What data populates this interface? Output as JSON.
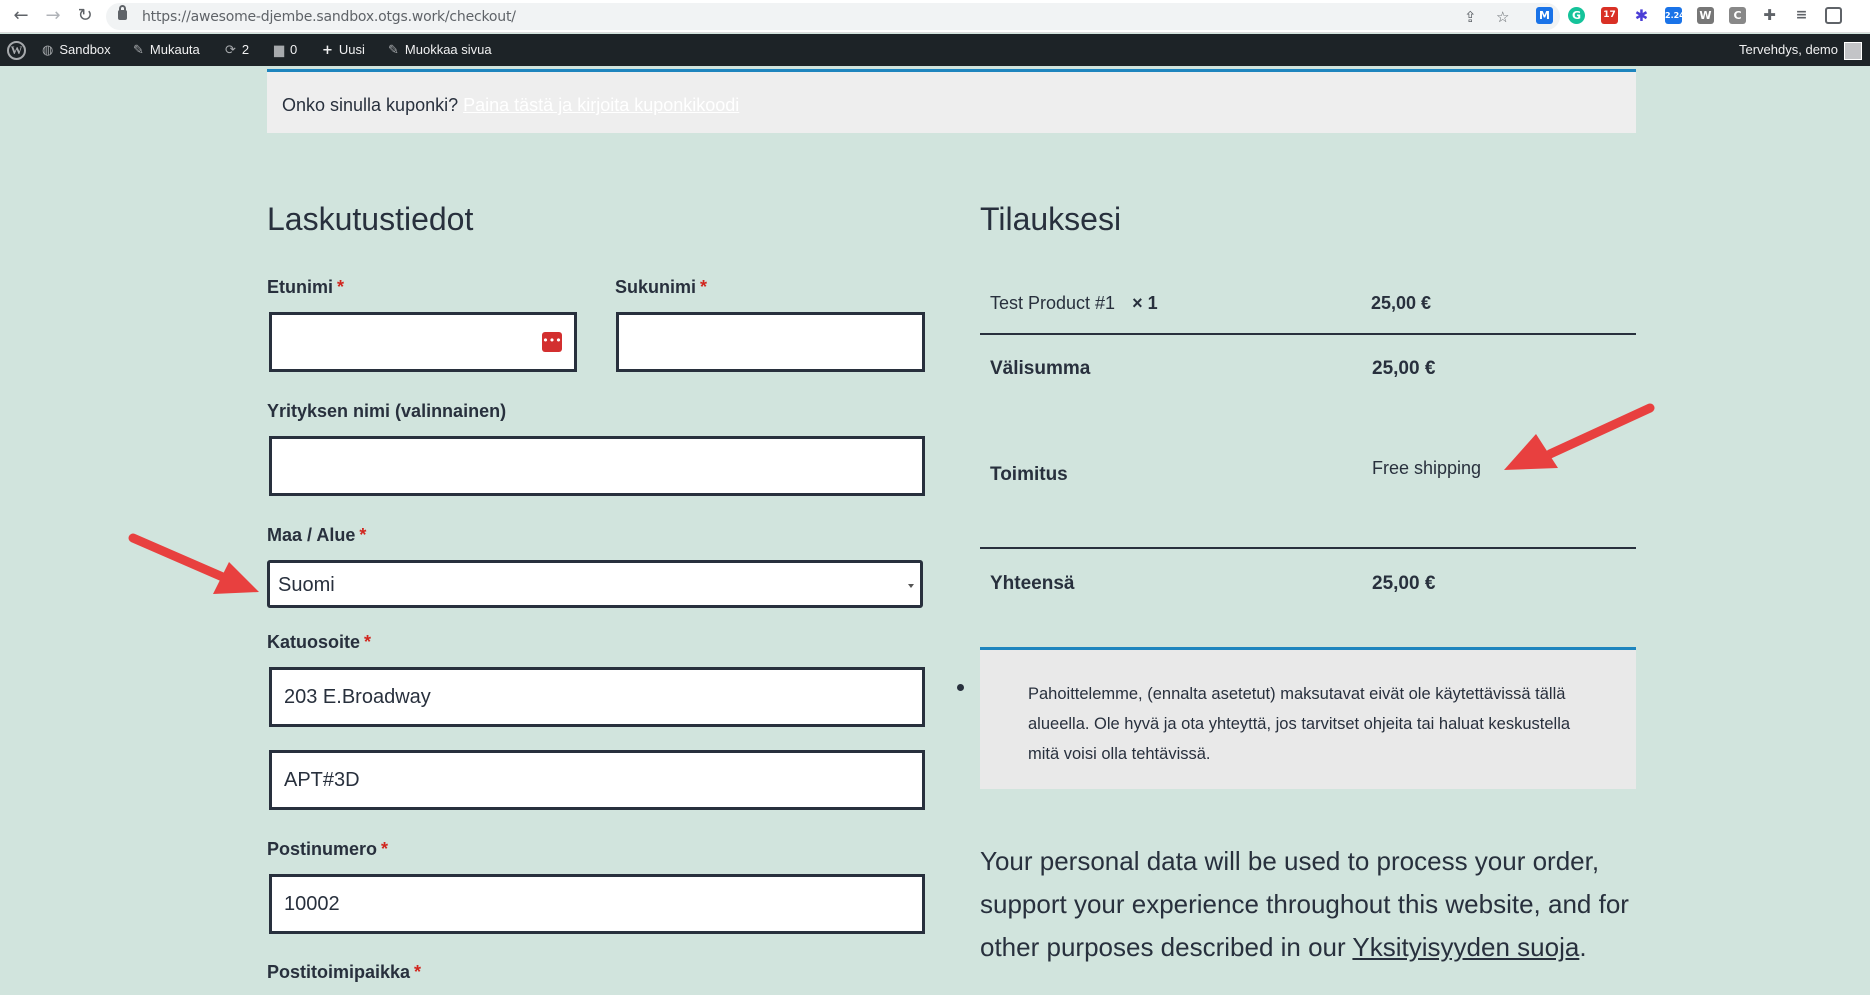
{
  "browser": {
    "url": "https://awesome-djembe.sandbox.otgs.work/checkout/",
    "extension_badges": [
      "17",
      "2.24"
    ]
  },
  "adminbar": {
    "wp_logo": "W",
    "site_name": "Sandbox",
    "customize": "Mukauta",
    "updates_count": "2",
    "comments_count": "0",
    "new_label": "Uusi",
    "edit_page": "Muokkaa sivua",
    "greeting": "Tervehdys, demo"
  },
  "coupon": {
    "question": "Onko sinulla kuponki?",
    "link": "Paina tästä ja kirjoita kuponkikoodi"
  },
  "billing": {
    "heading": "Laskutustiedot",
    "required_mark": "*",
    "first_name_label": "Etunimi",
    "first_name_value": "",
    "last_name_label": "Sukunimi",
    "last_name_value": "",
    "company_label": "Yrityksen nimi (valinnainen)",
    "company_value": "",
    "country_label": "Maa / Alue",
    "country_value": "Suomi",
    "street_label": "Katuosoite",
    "street_value": "203 E.Broadway",
    "street2_value": "APT#3D",
    "postcode_label": "Postinumero",
    "postcode_value": "10002",
    "city_label": "Postitoimipaikka"
  },
  "order": {
    "heading": "Tilauksesi",
    "product_name": "Test Product #1",
    "product_qty": "× 1",
    "product_price": "25,00 €",
    "subtotal_label": "Välisumma",
    "subtotal_value": "25,00 €",
    "shipping_label": "Toimitus",
    "shipping_value": "Free shipping",
    "total_label": "Yhteensä",
    "total_value": "25,00 €"
  },
  "notice": {
    "text": "Pahoittelemme, (ennalta asetetut) maksutavat eivät ole käytettävissä tällä alueella. Ole hyvä ja ota yhteyttä, jos tarvitset ohjeita tai haluat keskustella mitä voisi olla tehtävissä."
  },
  "privacy": {
    "text": "Your personal data will be used to process your order, support your experience throughout this website, and for other purposes described in our ",
    "link": "Yksityisyyden suoja",
    "end": "."
  },
  "colors": {
    "page_bg": "#d1e4dd",
    "text": "#28303d",
    "accent": "#1e85be",
    "required": "#d1261e",
    "annotation_arrow": "#e8403f",
    "adminbar_bg": "#1d2327"
  },
  "icons": {
    "back": "arrow-left-icon",
    "forward": "arrow-right-icon",
    "reload": "reload-icon",
    "lock": "lock-icon",
    "share": "share-icon",
    "star": "star-icon",
    "extensions": "puzzle-icon",
    "password_manager": "password-manager-icon"
  }
}
